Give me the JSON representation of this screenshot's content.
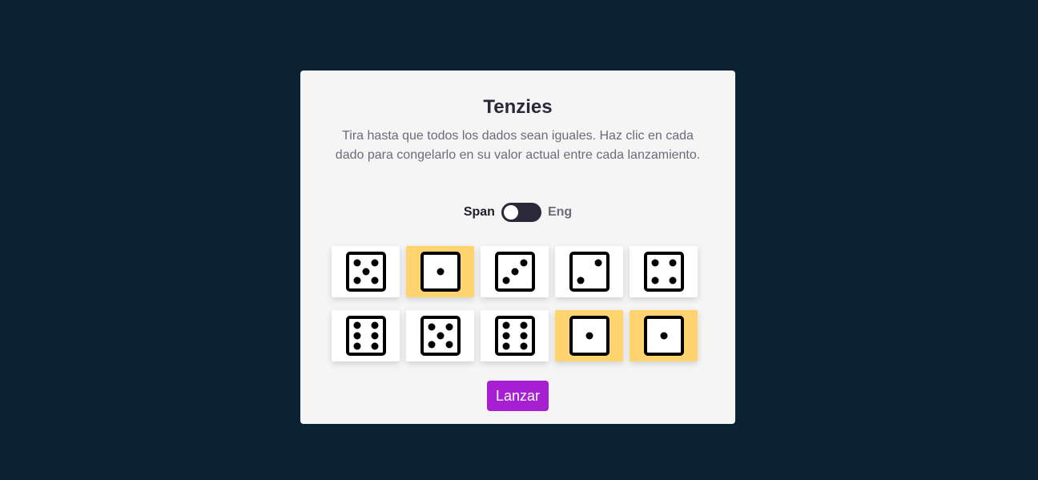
{
  "game": {
    "title": "Tenzies",
    "instructions": "Tira hasta que todos los dados sean iguales. Haz clic en cada dado para congelarlo en su valor actual entre cada lanzamiento."
  },
  "language_toggle": {
    "left_label": "Span",
    "right_label": "Eng",
    "selected": "Span"
  },
  "dice": [
    {
      "value": 5,
      "held": false
    },
    {
      "value": 1,
      "held": true
    },
    {
      "value": 3,
      "held": false
    },
    {
      "value": 2,
      "held": false
    },
    {
      "value": 4,
      "held": false
    },
    {
      "value": 6,
      "held": false
    },
    {
      "value": 5,
      "held": false
    },
    {
      "value": 6,
      "held": false
    },
    {
      "value": 1,
      "held": true
    },
    {
      "value": 1,
      "held": true
    }
  ],
  "roll_button": {
    "label": "Lanzar"
  },
  "colors": {
    "background": "#0b2233",
    "card": "#f5f5f5",
    "die": "#ffffff",
    "held_die": "#ffd36e",
    "button": "#a61fd0",
    "toggle": "#2b283a"
  },
  "icons": {
    "die_face": "die-face-icon"
  }
}
